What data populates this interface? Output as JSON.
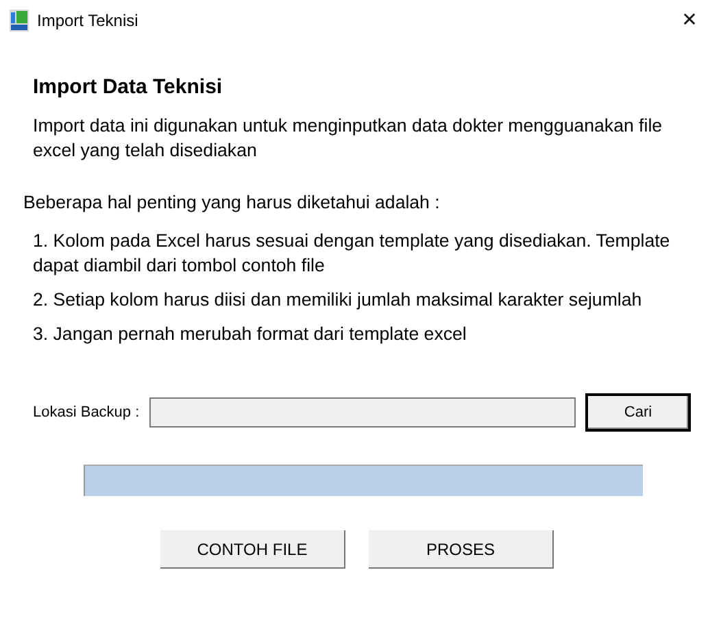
{
  "window": {
    "title": "Import Teknisi",
    "close": "✕"
  },
  "heading": "Import Data Teknisi",
  "description": "Import data ini digunakan untuk menginputkan data dokter mengguanakan file excel yang telah disediakan",
  "notes_intro": "Beberapa hal penting yang harus diketahui adalah :",
  "notes": [
    "1. Kolom pada Excel harus sesuai dengan template yang disediakan. Template dapat diambil dari tombol contoh file",
    "2. Setiap kolom harus diisi dan memiliki jumlah maksimal karakter sejumlah",
    "3. Jangan pernah merubah format dari template excel"
  ],
  "backup": {
    "label": "Lokasi Backup :",
    "button": "Cari"
  },
  "buttons": [
    "CONTOH FILE",
    "PROSES"
  ]
}
